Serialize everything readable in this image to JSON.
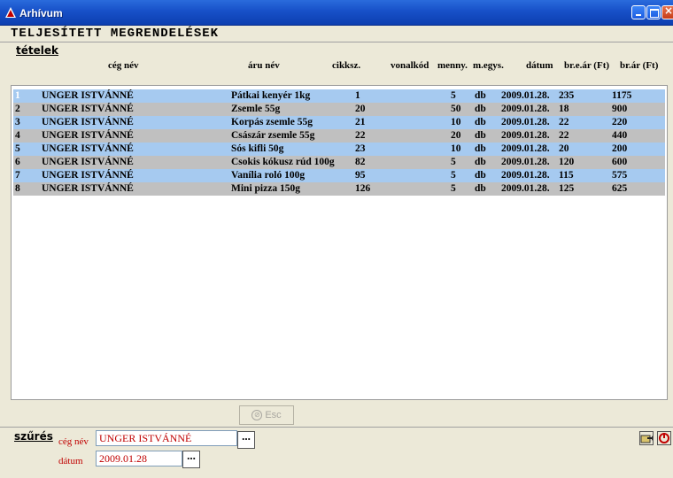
{
  "window": {
    "title": "Arhívum"
  },
  "page_title": "TELJESÍTETT MEGRENDELÉSEK",
  "items_section": {
    "label": "tételek"
  },
  "columns": [
    "cég név",
    "áru név",
    "cikksz.",
    "vonalkód",
    "menny.",
    "m.egys.",
    "dátum",
    "br.e.ár (Ft)",
    "br.ár (Ft)"
  ],
  "rows": [
    {
      "idx": "1",
      "company": "UNGER ISTVÁNNÉ",
      "product": "Pátkai kenyér 1kg",
      "sku": "1",
      "qty": "5",
      "unit": "db",
      "date": "2009.01.28.",
      "unit_price": "235",
      "price": "1175"
    },
    {
      "idx": "2",
      "company": "UNGER ISTVÁNNÉ",
      "product": "Zsemle 55g",
      "sku": "20",
      "qty": "50",
      "unit": "db",
      "date": "2009.01.28.",
      "unit_price": "18",
      "price": "900"
    },
    {
      "idx": "3",
      "company": "UNGER ISTVÁNNÉ",
      "product": "Korpás zsemle 55g",
      "sku": "21",
      "qty": "10",
      "unit": "db",
      "date": "2009.01.28.",
      "unit_price": "22",
      "price": "220"
    },
    {
      "idx": "4",
      "company": "UNGER ISTVÁNNÉ",
      "product": "Császár zsemle 55g",
      "sku": "22",
      "qty": "20",
      "unit": "db",
      "date": "2009.01.28.",
      "unit_price": "22",
      "price": "440"
    },
    {
      "idx": "5",
      "company": "UNGER ISTVÁNNÉ",
      "product": "Sós kifli 50g",
      "sku": "23",
      "qty": "10",
      "unit": "db",
      "date": "2009.01.28.",
      "unit_price": "20",
      "price": "200"
    },
    {
      "idx": "6",
      "company": "UNGER ISTVÁNNÉ",
      "product": "Csokis kókusz rúd 100g",
      "sku": "82",
      "qty": "5",
      "unit": "db",
      "date": "2009.01.28.",
      "unit_price": "120",
      "price": "600"
    },
    {
      "idx": "7",
      "company": "UNGER ISTVÁNNÉ",
      "product": "Vanília roló 100g",
      "sku": "95",
      "qty": "5",
      "unit": "db",
      "date": "2009.01.28.",
      "unit_price": "115",
      "price": "575"
    },
    {
      "idx": "8",
      "company": "UNGER ISTVÁNNÉ",
      "product": "Mini pizza 150g",
      "sku": "126",
      "qty": "5",
      "unit": "db",
      "date": "2009.01.28.",
      "unit_price": "125",
      "price": "625"
    }
  ],
  "esc_button": {
    "label": "Esc"
  },
  "filter": {
    "label": "szűrés",
    "company_label": "cég név",
    "company_value": "UNGER ISTVÁNNÉ",
    "date_label": "dátum",
    "date_value": "2009.01.28"
  },
  "dots": "...",
  "colors": {
    "row_blue": "#a6caf0",
    "row_gray": "#c0c0c0",
    "filter_text": "#c00000",
    "titlebar": "#1750c8"
  },
  "icons": {
    "title": "warning-triangle-icon",
    "open": "folder-arrow-icon",
    "exit": "power-off-icon"
  }
}
